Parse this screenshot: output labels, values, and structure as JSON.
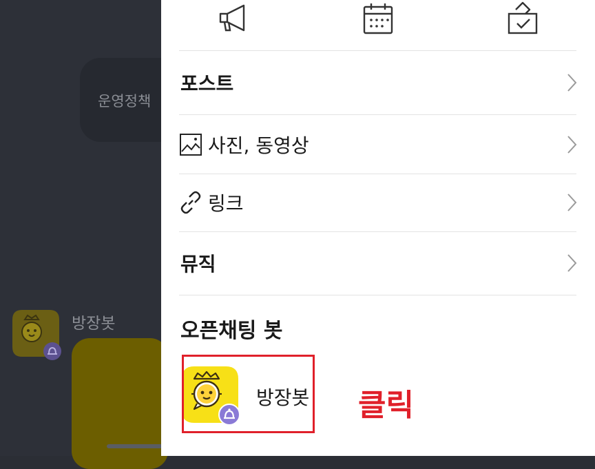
{
  "background_chat": {
    "notice_text": "운영정책",
    "bot_name": "방장봇"
  },
  "top_icons": [
    "megaphone-icon",
    "calendar-icon",
    "vote-box-icon"
  ],
  "menu": [
    {
      "label": "포스트",
      "icon": null,
      "bold": true
    },
    {
      "label": "사진, 동영상",
      "icon": "photo-icon",
      "bold": false
    },
    {
      "label": "링크",
      "icon": "link-icon",
      "bold": false
    },
    {
      "label": "뮤직",
      "icon": null,
      "bold": true
    }
  ],
  "bots_section": {
    "title": "오픈채팅 봇",
    "items": [
      {
        "name": "방장봇"
      }
    ]
  },
  "annotation": {
    "text": "클릭",
    "color": "#e0202a"
  },
  "colors": {
    "bot_yellow": "#f7e017",
    "bot_badge": "#8a7ad6",
    "dim_bg": "#2d3038"
  }
}
